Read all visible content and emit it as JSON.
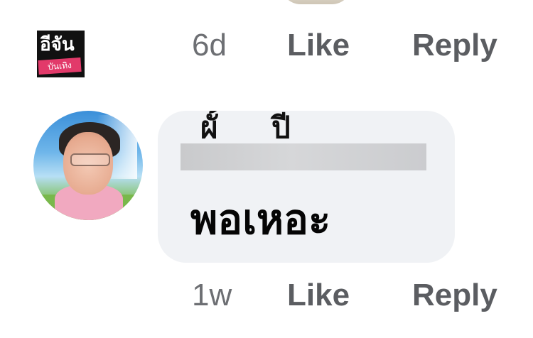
{
  "watermark": {
    "line1": "อีจัน",
    "line2": "บันเทิง"
  },
  "previous_comment": {
    "time": "6d",
    "like_label": "Like",
    "reply_label": "Reply"
  },
  "comment": {
    "author_fragment_1": "ผั้",
    "author_fragment_2": "ปี",
    "text": "พอเหอะ",
    "time": "1w",
    "like_label": "Like",
    "reply_label": "Reply"
  }
}
